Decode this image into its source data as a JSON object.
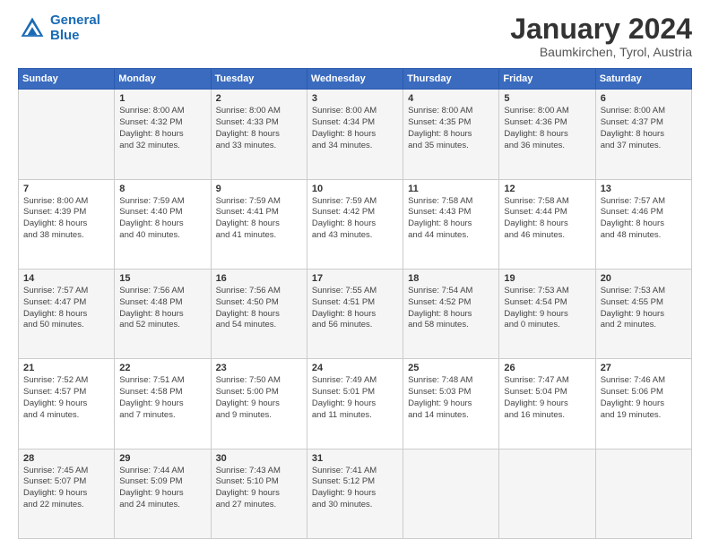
{
  "header": {
    "logo_line1": "General",
    "logo_line2": "Blue",
    "main_title": "January 2024",
    "subtitle": "Baumkirchen, Tyrol, Austria"
  },
  "days_of_week": [
    "Sunday",
    "Monday",
    "Tuesday",
    "Wednesday",
    "Thursday",
    "Friday",
    "Saturday"
  ],
  "weeks": [
    [
      {
        "day": "",
        "info": ""
      },
      {
        "day": "1",
        "info": "Sunrise: 8:00 AM\nSunset: 4:32 PM\nDaylight: 8 hours\nand 32 minutes."
      },
      {
        "day": "2",
        "info": "Sunrise: 8:00 AM\nSunset: 4:33 PM\nDaylight: 8 hours\nand 33 minutes."
      },
      {
        "day": "3",
        "info": "Sunrise: 8:00 AM\nSunset: 4:34 PM\nDaylight: 8 hours\nand 34 minutes."
      },
      {
        "day": "4",
        "info": "Sunrise: 8:00 AM\nSunset: 4:35 PM\nDaylight: 8 hours\nand 35 minutes."
      },
      {
        "day": "5",
        "info": "Sunrise: 8:00 AM\nSunset: 4:36 PM\nDaylight: 8 hours\nand 36 minutes."
      },
      {
        "day": "6",
        "info": "Sunrise: 8:00 AM\nSunset: 4:37 PM\nDaylight: 8 hours\nand 37 minutes."
      }
    ],
    [
      {
        "day": "7",
        "info": "Sunrise: 8:00 AM\nSunset: 4:39 PM\nDaylight: 8 hours\nand 38 minutes."
      },
      {
        "day": "8",
        "info": "Sunrise: 7:59 AM\nSunset: 4:40 PM\nDaylight: 8 hours\nand 40 minutes."
      },
      {
        "day": "9",
        "info": "Sunrise: 7:59 AM\nSunset: 4:41 PM\nDaylight: 8 hours\nand 41 minutes."
      },
      {
        "day": "10",
        "info": "Sunrise: 7:59 AM\nSunset: 4:42 PM\nDaylight: 8 hours\nand 43 minutes."
      },
      {
        "day": "11",
        "info": "Sunrise: 7:58 AM\nSunset: 4:43 PM\nDaylight: 8 hours\nand 44 minutes."
      },
      {
        "day": "12",
        "info": "Sunrise: 7:58 AM\nSunset: 4:44 PM\nDaylight: 8 hours\nand 46 minutes."
      },
      {
        "day": "13",
        "info": "Sunrise: 7:57 AM\nSunset: 4:46 PM\nDaylight: 8 hours\nand 48 minutes."
      }
    ],
    [
      {
        "day": "14",
        "info": "Sunrise: 7:57 AM\nSunset: 4:47 PM\nDaylight: 8 hours\nand 50 minutes."
      },
      {
        "day": "15",
        "info": "Sunrise: 7:56 AM\nSunset: 4:48 PM\nDaylight: 8 hours\nand 52 minutes."
      },
      {
        "day": "16",
        "info": "Sunrise: 7:56 AM\nSunset: 4:50 PM\nDaylight: 8 hours\nand 54 minutes."
      },
      {
        "day": "17",
        "info": "Sunrise: 7:55 AM\nSunset: 4:51 PM\nDaylight: 8 hours\nand 56 minutes."
      },
      {
        "day": "18",
        "info": "Sunrise: 7:54 AM\nSunset: 4:52 PM\nDaylight: 8 hours\nand 58 minutes."
      },
      {
        "day": "19",
        "info": "Sunrise: 7:53 AM\nSunset: 4:54 PM\nDaylight: 9 hours\nand 0 minutes."
      },
      {
        "day": "20",
        "info": "Sunrise: 7:53 AM\nSunset: 4:55 PM\nDaylight: 9 hours\nand 2 minutes."
      }
    ],
    [
      {
        "day": "21",
        "info": "Sunrise: 7:52 AM\nSunset: 4:57 PM\nDaylight: 9 hours\nand 4 minutes."
      },
      {
        "day": "22",
        "info": "Sunrise: 7:51 AM\nSunset: 4:58 PM\nDaylight: 9 hours\nand 7 minutes."
      },
      {
        "day": "23",
        "info": "Sunrise: 7:50 AM\nSunset: 5:00 PM\nDaylight: 9 hours\nand 9 minutes."
      },
      {
        "day": "24",
        "info": "Sunrise: 7:49 AM\nSunset: 5:01 PM\nDaylight: 9 hours\nand 11 minutes."
      },
      {
        "day": "25",
        "info": "Sunrise: 7:48 AM\nSunset: 5:03 PM\nDaylight: 9 hours\nand 14 minutes."
      },
      {
        "day": "26",
        "info": "Sunrise: 7:47 AM\nSunset: 5:04 PM\nDaylight: 9 hours\nand 16 minutes."
      },
      {
        "day": "27",
        "info": "Sunrise: 7:46 AM\nSunset: 5:06 PM\nDaylight: 9 hours\nand 19 minutes."
      }
    ],
    [
      {
        "day": "28",
        "info": "Sunrise: 7:45 AM\nSunset: 5:07 PM\nDaylight: 9 hours\nand 22 minutes."
      },
      {
        "day": "29",
        "info": "Sunrise: 7:44 AM\nSunset: 5:09 PM\nDaylight: 9 hours\nand 24 minutes."
      },
      {
        "day": "30",
        "info": "Sunrise: 7:43 AM\nSunset: 5:10 PM\nDaylight: 9 hours\nand 27 minutes."
      },
      {
        "day": "31",
        "info": "Sunrise: 7:41 AM\nSunset: 5:12 PM\nDaylight: 9 hours\nand 30 minutes."
      },
      {
        "day": "",
        "info": ""
      },
      {
        "day": "",
        "info": ""
      },
      {
        "day": "",
        "info": ""
      }
    ]
  ]
}
